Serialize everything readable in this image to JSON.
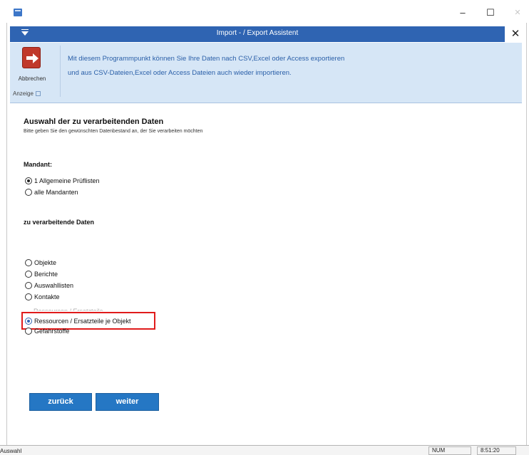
{
  "window": {
    "minimize_glyph": "–",
    "maximize_glyph": "☐",
    "close_glyph": "✕"
  },
  "dialog": {
    "title": "Import - / Export Assistent",
    "close_glyph": "✕"
  },
  "ribbon": {
    "cancel_label": "Abbrechen",
    "group_label": "Anzeige",
    "info_line1": "Mit diesem Programmpunkt können Sie Ihre Daten nach CSV,Excel oder Access exportieren",
    "info_line2": "und aus CSV-Dateien,Excel  oder Access Dateien auch wieder importieren."
  },
  "content": {
    "heading": "Auswahl der zu verarbeitenden Daten",
    "subheading": "Bitte geben Sie den gewünschten Datenbestand an, der Sie verarbeiten möchten",
    "mandant_label": "Mandant:",
    "mandant_options": [
      {
        "label": "1 Allgemeine Prüflisten",
        "selected": true
      },
      {
        "label": "alle Mandanten",
        "selected": false
      }
    ],
    "data_label": "zu verarbeitende Daten",
    "data_options": [
      {
        "label": "Objekte",
        "selected": false
      },
      {
        "label": "Berichte",
        "selected": false
      },
      {
        "label": "Auswahllisten",
        "selected": false
      },
      {
        "label": "Kontakte",
        "selected": false
      },
      {
        "label": "Ressourcen / Ersatzteile",
        "selected": false
      },
      {
        "label": "Ressourcen / Ersatzteile je Objekt",
        "selected": true
      },
      {
        "label": "Gefahrstoffe",
        "selected": false
      }
    ]
  },
  "buttons": {
    "back": "zurück",
    "next": "weiter"
  },
  "statusbar": {
    "left": "Auswahl",
    "num": "NUM",
    "time": "8:51:20"
  },
  "colors": {
    "title_bar": "#2f64b2",
    "ribbon_bg": "#d6e6f6",
    "button_bg": "#2577c4",
    "highlight": "#e01b1b",
    "info_text": "#2a5fa8"
  }
}
